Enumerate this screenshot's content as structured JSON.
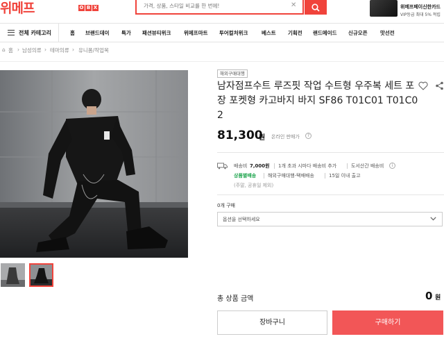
{
  "header": {
    "logo": "위메프",
    "promo_badge": [
      "O",
      "B",
      "X"
    ],
    "search_placeholder": "가격, 상품, 스타일 비교를 한 번에!",
    "card_title": "위메프페이신한카드",
    "card_sub": "VIP등급 최대 5% 적립"
  },
  "nav": {
    "category_label": "전체 카테고리",
    "items": [
      "홈",
      "브랜드데이",
      "특가",
      "패션뷰티위크",
      "위메프마트",
      "투어컬처위크",
      "베스트",
      "기획전",
      "랜드메이드",
      "신규오픈",
      "맛선전"
    ]
  },
  "breadcrumb": [
    "홈",
    "남성의류",
    "테마의류",
    "유니폼/작업복"
  ],
  "product": {
    "badge": "해외구매대행",
    "title": "남자점프수트 루즈핏 작업 수트형 우주복 세트 포장 포켓형 카고바지 바지 SF86 T01C01 T01C02",
    "price": "81,300",
    "price_unit": "원",
    "price_note": "온라인 판매가",
    "help": "?"
  },
  "shipping": {
    "fee_label": "배송비",
    "fee_value": "7,000원",
    "condition": "1개 초과 시마다 배송비 추가",
    "island": "도서산간 배송비",
    "info": "i",
    "link": "상품별배송",
    "method": "해외구매대행-택배배송",
    "eta": "15일 이내 출고",
    "note": "(주말, 공휴일 제외)"
  },
  "options": {
    "label": "0개 구매",
    "select_placeholder": "옵션을 선택하세요"
  },
  "total": {
    "label": "총 상품 금액",
    "value": "0",
    "unit": "원"
  },
  "buttons": {
    "cart": "장바구니",
    "buy": "구매하기"
  },
  "colors": {
    "brand": "#f0433b",
    "buy_button": "#f25657",
    "shipping_link": "#1aa34a"
  },
  "icons": [
    "hamburger-icon",
    "home-icon",
    "search-icon",
    "close-icon",
    "heart-icon",
    "share-icon",
    "truck-icon",
    "chevron-down-icon"
  ]
}
